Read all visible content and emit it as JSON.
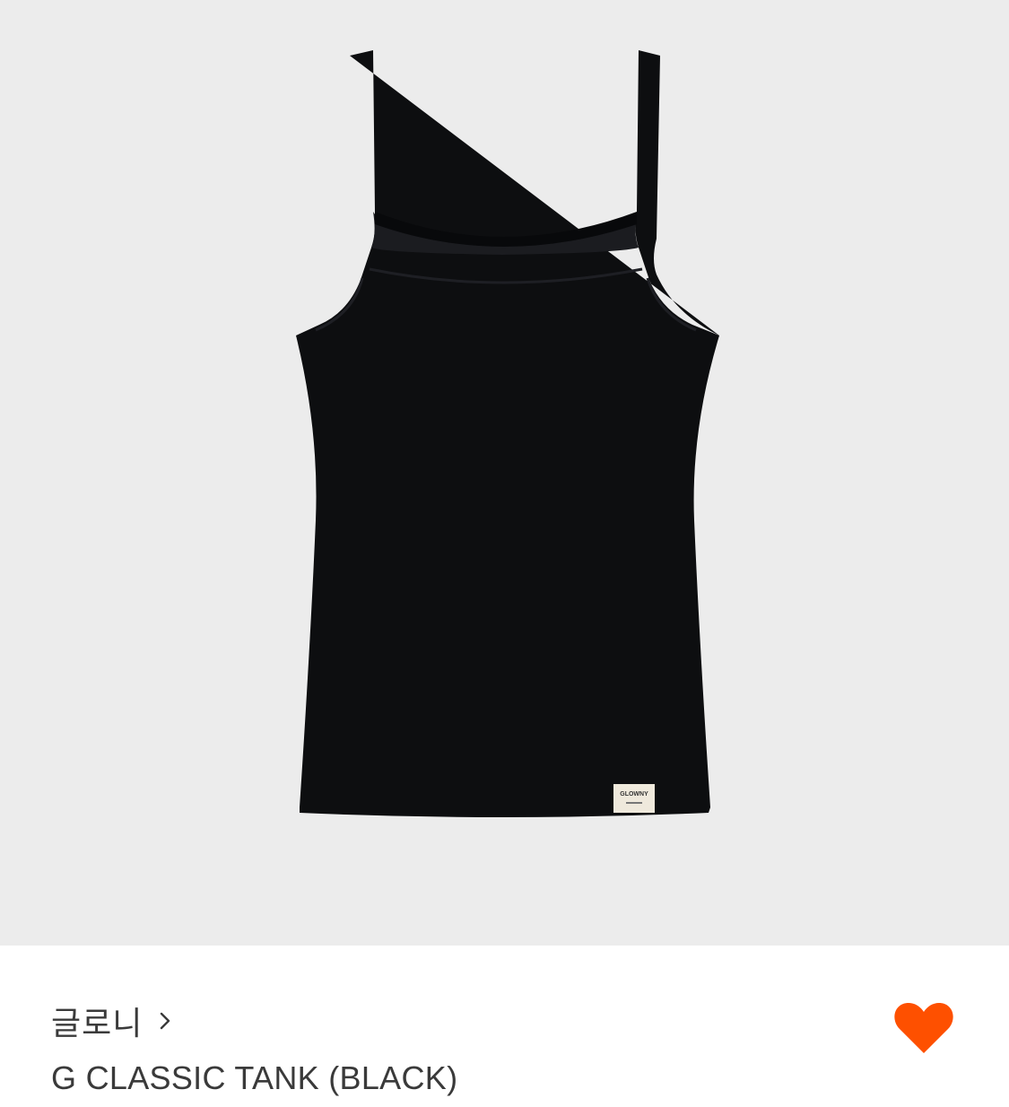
{
  "product": {
    "image_alt": "G CLASSIC TANK (BLACK)",
    "label_text": "GLOWNY",
    "image_bg": "#ececec",
    "garment_color": "#0d0e10"
  },
  "brand": {
    "name": "글로니",
    "chevron_icon": "chevron-right-icon"
  },
  "title": "G CLASSIC TANK (BLACK)",
  "like": {
    "icon": "heart-icon",
    "active": true,
    "color": "#fe5000"
  }
}
